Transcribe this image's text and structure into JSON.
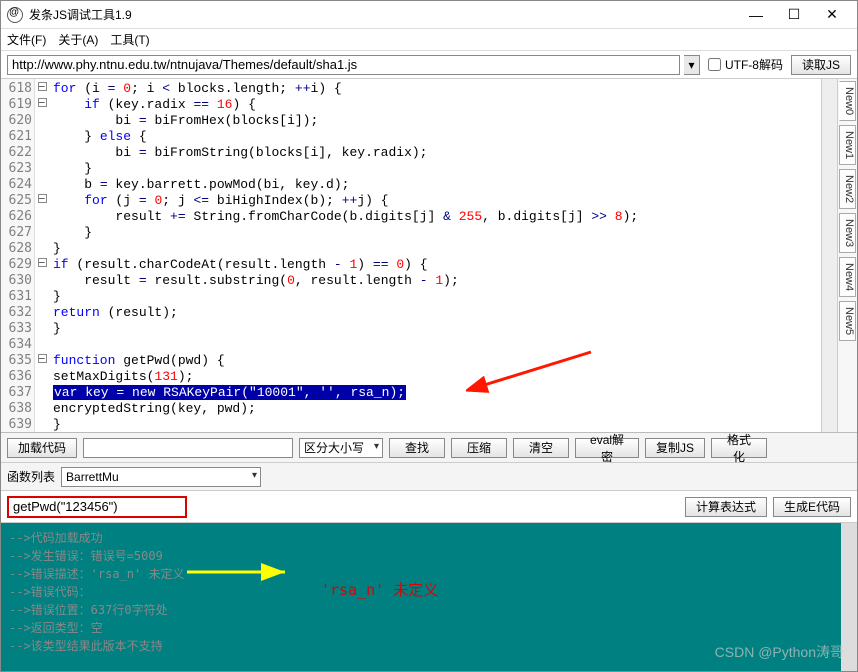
{
  "window": {
    "title": "发条JS调试工具1.9"
  },
  "menu": {
    "file": "文件(F)",
    "about": "关于(A)",
    "tools": "工具(T)"
  },
  "toolbar": {
    "url": "http://www.phy.ntnu.edu.tw/ntnujava/Themes/default/sha1.js",
    "utf8_label": "UTF-8解码",
    "read_js": "读取JS"
  },
  "code": {
    "lines": [
      "618",
      "619",
      "620",
      "621",
      "622",
      "623",
      "624",
      "625",
      "626",
      "627",
      "628",
      "629",
      "630",
      "631",
      "632",
      "633",
      "634",
      "635",
      "636",
      "637",
      "638",
      "639"
    ]
  },
  "side_tabs": [
    "New0",
    "New1",
    "New2",
    "New3",
    "New4",
    "New5"
  ],
  "mid": {
    "load_code": "加载代码",
    "case_sens": "区分大小写",
    "find": "查找",
    "compress": "压缩",
    "clear": "清空",
    "eval": "eval解密",
    "copyjs": "复制JS",
    "format": "格式化"
  },
  "func": {
    "label": "函数列表",
    "selected": "BarrettMu"
  },
  "expr": {
    "value": "getPwd(\"123456\")",
    "calc": "计算表达式",
    "gen": "生成E代码"
  },
  "console": {
    "l1": "-->代码加载成功",
    "l2": "-->发生错误：错误号=5009",
    "l3": "-->错误描述：'rsa_n' 未定义",
    "l4": "-->错误代码：",
    "l5": "-->错误位置：637行0字符处",
    "l6": "-->返回类型：空",
    "l7": "-->该类型结果此版本不支持"
  },
  "annotation": {
    "rsa": "'rsa_n' 未定义"
  },
  "watermark": "CSDN @Python涛哥"
}
